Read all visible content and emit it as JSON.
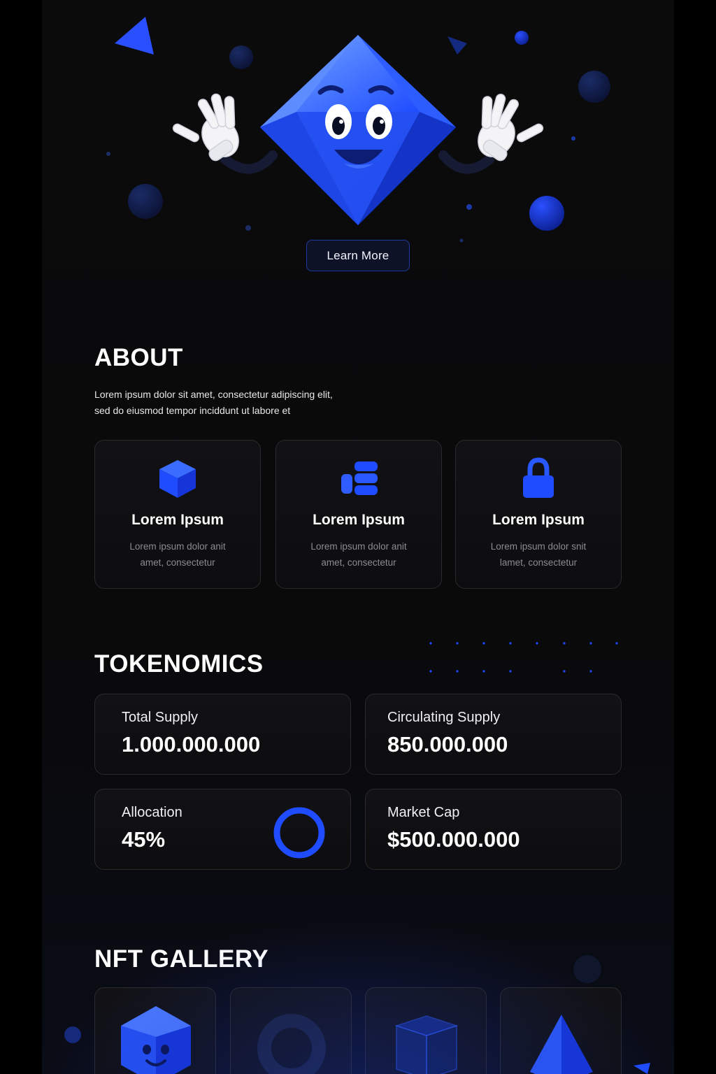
{
  "colors": {
    "background": "#0a0a0b",
    "accent": "#1f4cff",
    "card_border": "#2a2a2e",
    "muted_text": "#8b8b92"
  },
  "hero": {
    "mascot": "blue-diamond-mascot",
    "cta_label": "Learn More"
  },
  "about": {
    "title": "ABOUT",
    "text_line1": "Lorem ipsum dolor sit amet, consectetur adipiscing elit,",
    "text_line2": "sed do eiusmod tempor inciddunt ut labore et",
    "features": [
      {
        "icon": "cube-icon",
        "title": "Lorem Ipsum",
        "desc_line1": "Lorem ipsum dolor anit",
        "desc_line2": "amet, consectetur"
      },
      {
        "icon": "blocks-icon",
        "title": "Lorem Ipsum",
        "desc_line1": "Lorem ipsum dolor anit",
        "desc_line2": "amet, consectetur"
      },
      {
        "icon": "lock-icon",
        "title": "Lorem Ipsum",
        "desc_line1": "Lorem ipsum dolor snit",
        "desc_line2": "lamet, consectetur"
      }
    ]
  },
  "tokenomics": {
    "title": "TOKENOMICS",
    "stats": [
      {
        "label": "Total Supply",
        "value": "1.000.000.000"
      },
      {
        "label": "Circulating Supply",
        "value": "850.000.000"
      },
      {
        "label": "Allocation",
        "value": "45%"
      },
      {
        "label": "Market Cap",
        "value": "$500.000.000"
      }
    ]
  },
  "gallery": {
    "title": "NFT GALLERY",
    "items": [
      "diamond-face-nft",
      "ring-nft",
      "glass-cube-nft",
      "pyramid-nft"
    ]
  }
}
